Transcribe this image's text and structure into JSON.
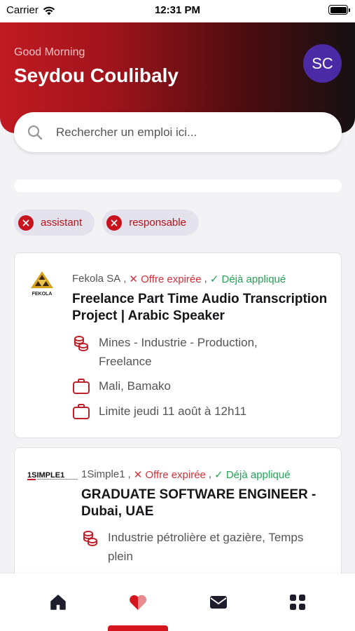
{
  "status_bar": {
    "carrier": "Carrier",
    "time": "12:31 PM"
  },
  "header": {
    "greeting": "Good Morning",
    "user_name": "Seydou Coulibaly",
    "avatar_initials": "SC"
  },
  "search": {
    "placeholder": "Rechercher un emploi ici..."
  },
  "filters": [
    {
      "label": "assistant"
    },
    {
      "label": "responsable"
    }
  ],
  "jobs": [
    {
      "logo_text": "FEKOLA",
      "company": "Fekola SA",
      "status_expired": "Offre expirée",
      "status_applied": "Déjà appliqué",
      "title": "Freelance Part Time Audio Transcription Project | Arabic Speaker",
      "sector": "Mines - Industrie - Production, Freelance",
      "location": "Mali, Bamako",
      "deadline": "Limite jeudi 11 août à 12h11"
    },
    {
      "logo_text": "1SIMPLE1",
      "company": "1Simple1",
      "status_expired": "Offre expirée",
      "status_applied": "Déjà appliqué",
      "title": "GRADUATE SOFTWARE ENGINEER - Dubai, UAE",
      "sector": "Industrie pétrolière et gazière, Temps plein"
    }
  ],
  "bottom_nav": {
    "items": [
      "home-icon",
      "favorites-icon",
      "messages-icon",
      "apps-icon"
    ],
    "active_index": 1
  },
  "colors": {
    "accent": "#d6161f",
    "avatar": "#4b2aa6",
    "expired": "#d6303a",
    "applied": "#22a455"
  }
}
